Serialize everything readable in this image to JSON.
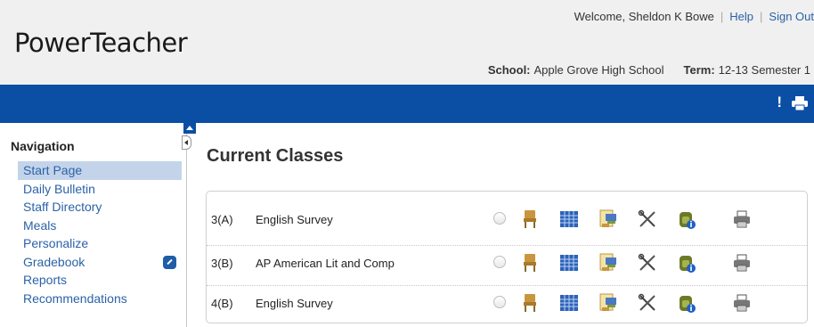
{
  "header": {
    "logo": "PowerTeacher",
    "welcome": "Welcome, Sheldon K Bowe",
    "help": "Help",
    "sign_out": "Sign Out",
    "school_label": "School:",
    "school_value": "Apple Grove High School",
    "term_label": "Term:",
    "term_value": "12-13 Semester 1"
  },
  "toolbar": {
    "alert_glyph": "!"
  },
  "navigation": {
    "title": "Navigation",
    "items": [
      {
        "label": "Start Page",
        "active": true
      },
      {
        "label": "Daily Bulletin"
      },
      {
        "label": "Staff Directory"
      },
      {
        "label": "Meals"
      },
      {
        "label": "Personalize"
      },
      {
        "label": "Gradebook",
        "icon": "gradebook-launch-icon"
      },
      {
        "label": "Reports"
      },
      {
        "label": "Recommendations"
      }
    ]
  },
  "main": {
    "title": "Current Classes",
    "classes": [
      {
        "period": "3(A)",
        "name": "English Survey"
      },
      {
        "period": "3(B)",
        "name": "AP American Lit and Comp"
      },
      {
        "period": "4(B)",
        "name": "English Survey"
      }
    ],
    "row_icons": [
      "radio-button",
      "attendance-chair-icon",
      "grid-calendar-icon",
      "seating-chart-icon",
      "tools-icon",
      "backpack-info-icon",
      "print-icon"
    ]
  },
  "colors": {
    "brand_blue": "#0a4fa3",
    "link": "#2b62a8",
    "nav_active": "#c3d4ea"
  }
}
